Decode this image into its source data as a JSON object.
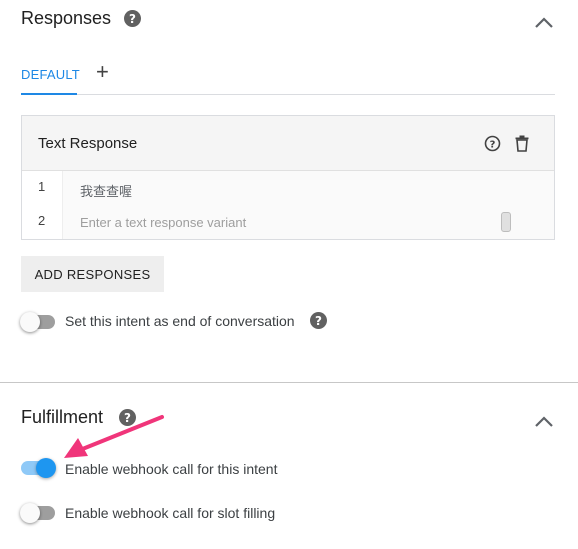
{
  "responses": {
    "title": "Responses",
    "tabs": [
      {
        "label": "DEFAULT",
        "active": true
      }
    ],
    "add_tab_symbol": "+",
    "card": {
      "title": "Text Response",
      "rows": [
        {
          "number": "1",
          "text": "我查查喔",
          "placeholder": ""
        },
        {
          "number": "2",
          "text": "",
          "placeholder": "Enter a text response variant"
        }
      ]
    },
    "add_button_label": "ADD RESPONSES",
    "end_conversation": {
      "label": "Set this intent as end of conversation",
      "enabled": false
    }
  },
  "fulfillment": {
    "title": "Fulfillment",
    "webhook_intent": {
      "label": "Enable webhook call for this intent",
      "enabled": true
    },
    "webhook_slot": {
      "label": "Enable webhook call for slot filling",
      "enabled": false
    }
  },
  "colors": {
    "accent": "#1e88e5",
    "annotation_arrow": "#f0357a"
  },
  "icons": {
    "help": "?",
    "add": "+",
    "chevron_up": "chevron-up",
    "delete": "trash"
  }
}
